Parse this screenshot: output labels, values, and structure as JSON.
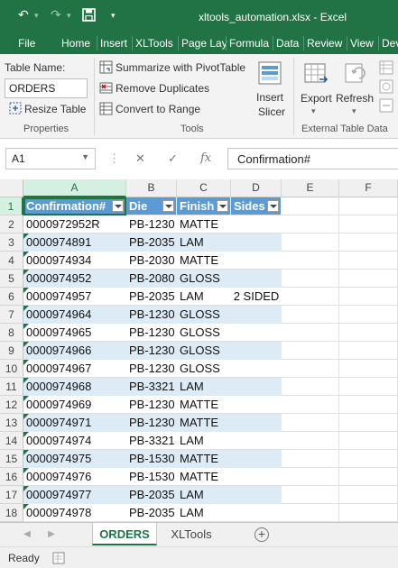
{
  "window": {
    "title": "xltools_automation.xlsx - Excel"
  },
  "quick_access": {
    "undo_icon": "undo-icon",
    "redo_icon": "redo-icon",
    "save_icon": "save-icon",
    "customize_icon": "customize-qat-icon"
  },
  "menu": {
    "tabs": [
      "File",
      "Home",
      "Insert",
      "XLTools",
      "Page Lay",
      "Formula",
      "Data",
      "Review",
      "View",
      "Dev"
    ]
  },
  "ribbon": {
    "properties": {
      "table_name_label": "Table Name:",
      "table_name_value": "ORDERS",
      "resize_table": "Resize Table",
      "group_label": "Properties"
    },
    "tools": {
      "summarize": "Summarize with PivotTable",
      "remove_duplicates": "Remove Duplicates",
      "convert_to_range": "Convert to Range",
      "insert_slicer_line1": "Insert",
      "insert_slicer_line2": "Slicer",
      "group_label": "Tools"
    },
    "external": {
      "export": "Export",
      "refresh": "Refresh",
      "group_label": "External Table Data"
    }
  },
  "formula_bar": {
    "name_box": "A1",
    "cancel_icon": "cancel-icon",
    "enter_icon": "enter-icon",
    "fx": "fx",
    "formula": "Confirmation#"
  },
  "grid": {
    "columns": [
      "A",
      "B",
      "C",
      "D",
      "E",
      "F"
    ],
    "selected_cell": "A1",
    "header": [
      "Confirmation#",
      "Die",
      "Finish",
      "Sides"
    ],
    "rows": [
      {
        "num": "2",
        "cells": [
          "0000972952R",
          "PB-1230",
          "MATTE",
          ""
        ]
      },
      {
        "num": "3",
        "cells": [
          "0000974891",
          "PB-2035",
          "LAM",
          ""
        ]
      },
      {
        "num": "4",
        "cells": [
          "0000974934",
          "PB-2030",
          "MATTE",
          ""
        ]
      },
      {
        "num": "5",
        "cells": [
          "0000974952",
          "PB-2080",
          "GLOSS",
          ""
        ]
      },
      {
        "num": "6",
        "cells": [
          "0000974957",
          "PB-2035",
          "LAM",
          "2 SIDED"
        ]
      },
      {
        "num": "7",
        "cells": [
          "0000974964",
          "PB-1230",
          "GLOSS",
          ""
        ]
      },
      {
        "num": "8",
        "cells": [
          "0000974965",
          "PB-1230",
          "GLOSS",
          ""
        ]
      },
      {
        "num": "9",
        "cells": [
          "0000974966",
          "PB-1230",
          "GLOSS",
          ""
        ]
      },
      {
        "num": "10",
        "cells": [
          "0000974967",
          "PB-1230",
          "GLOSS",
          ""
        ]
      },
      {
        "num": "11",
        "cells": [
          "0000974968",
          "PB-3321",
          "LAM",
          ""
        ]
      },
      {
        "num": "12",
        "cells": [
          "0000974969",
          "PB-1230",
          "MATTE",
          ""
        ]
      },
      {
        "num": "13",
        "cells": [
          "0000974971",
          "PB-1230",
          "MATTE",
          ""
        ]
      },
      {
        "num": "14",
        "cells": [
          "0000974974",
          "PB-3321",
          "LAM",
          ""
        ]
      },
      {
        "num": "15",
        "cells": [
          "0000974975",
          "PB-1530",
          "MATTE",
          ""
        ]
      },
      {
        "num": "16",
        "cells": [
          "0000974976",
          "PB-1530",
          "MATTE",
          ""
        ]
      },
      {
        "num": "17",
        "cells": [
          "0000974977",
          "PB-2035",
          "LAM",
          ""
        ]
      },
      {
        "num": "18",
        "cells": [
          "0000974978",
          "PB-2035",
          "LAM",
          ""
        ]
      }
    ]
  },
  "sheets": {
    "tabs": [
      "ORDERS",
      "XLTools"
    ],
    "active": "ORDERS"
  },
  "status": {
    "text": "Ready"
  },
  "colors": {
    "brand": "#217346",
    "table_header": "#5b9bd5",
    "table_band": "#ddebf7"
  }
}
